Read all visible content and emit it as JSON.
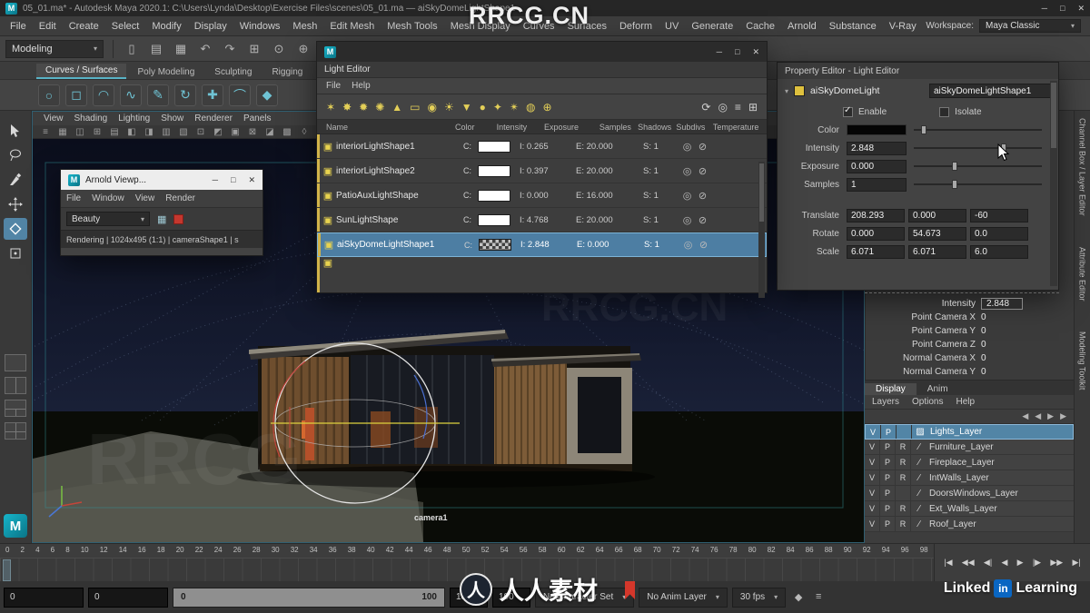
{
  "title_bar": {
    "title": "05_01.ma* - Autodesk Maya 2020.1: C:\\Users\\Lynda\\Desktop\\Exercise Files\\scenes\\05_01.ma — aiSkyDomeLightShape1",
    "app_icon": "M",
    "controls": [
      "─",
      "□",
      "✕"
    ]
  },
  "menu_bar": {
    "items": [
      "File",
      "Edit",
      "Create",
      "Select",
      "Modify",
      "Display",
      "Windows",
      "Mesh",
      "Edit Mesh",
      "Mesh Tools",
      "Mesh Display",
      "Curves",
      "Surfaces",
      "Deform",
      "UV",
      "Generate",
      "Cache",
      "Arnold",
      "Substance",
      "V-Ray"
    ],
    "workspace_label": "Workspace:",
    "workspace_value": "Maya Classic"
  },
  "toolbar": {
    "mode": "Modeling",
    "icons": [
      {
        "name": "new-scene-icon",
        "glyph": "▯"
      },
      {
        "name": "open-scene-icon",
        "glyph": "▤"
      },
      {
        "name": "save-scene-icon",
        "glyph": "▦"
      },
      {
        "name": "undo-icon",
        "glyph": "↶"
      },
      {
        "name": "redo-icon",
        "glyph": "↷"
      },
      {
        "name": "snap-to-grid-icon",
        "glyph": "⊞"
      },
      {
        "name": "snap-to-curve-icon",
        "glyph": "⊙"
      },
      {
        "name": "snap-to-point-icon",
        "glyph": "⊕"
      },
      {
        "name": "snap-to-plane-icon",
        "glyph": "▣"
      },
      {
        "name": "make-live-icon",
        "glyph": "◧"
      },
      {
        "name": "construction-history-icon",
        "glyph": "✛"
      },
      {
        "name": "render-icon",
        "glyph": "▩"
      }
    ]
  },
  "shelf": {
    "tabs": [
      "Curves / Surfaces",
      "Poly Modeling",
      "Sculpting",
      "Rigging"
    ],
    "icons": [
      {
        "name": "nurbs-circle-icon",
        "glyph": "○"
      },
      {
        "name": "nurbs-square-icon",
        "glyph": "◻"
      },
      {
        "name": "curve-arc-icon",
        "glyph": "◠"
      },
      {
        "name": "freehand-curve-icon",
        "glyph": "∿"
      },
      {
        "name": "pencil-curve-icon",
        "glyph": "✎"
      },
      {
        "name": "revolve-icon",
        "glyph": "↻"
      },
      {
        "name": "add-points-icon",
        "glyph": "✚"
      },
      {
        "name": "arc-tool-icon",
        "glyph": "⌒"
      },
      {
        "name": "bezier-icon",
        "glyph": "◆"
      }
    ]
  },
  "viewport": {
    "menus": [
      "View",
      "Shading",
      "Lighting",
      "Show",
      "Renderer",
      "Panels"
    ],
    "icons": [
      {
        "name": "select-camera-icon",
        "glyph": "≡"
      },
      {
        "name": "grid-toggle-icon",
        "glyph": "▦"
      },
      {
        "name": "film-gate-icon",
        "glyph": "◫"
      },
      {
        "name": "resolution-gate-icon",
        "glyph": "⊞"
      },
      {
        "name": "gate-mask-icon",
        "glyph": "▤"
      },
      {
        "name": "field-chart-icon",
        "glyph": "◧"
      },
      {
        "name": "safe-action-icon",
        "glyph": "◨"
      },
      {
        "name": "safe-title-icon",
        "glyph": "▥"
      },
      {
        "name": "wireframe-icon",
        "glyph": "▧"
      },
      {
        "name": "shaded-icon",
        "glyph": "⊡"
      },
      {
        "name": "textured-icon",
        "glyph": "◩"
      },
      {
        "name": "lighting-icon",
        "glyph": "▣"
      },
      {
        "name": "shadows-icon",
        "glyph": "⊠"
      },
      {
        "name": "ambient-occlusion-icon",
        "glyph": "◪"
      },
      {
        "name": "motion-blur-icon",
        "glyph": "▩"
      },
      {
        "name": "isolate-select-icon",
        "glyph": "◊"
      }
    ],
    "camera_label": "camera1"
  },
  "arnold_window": {
    "title": "Arnold Viewp...",
    "controls": [
      "─",
      "□",
      "✕"
    ],
    "menus": [
      "File",
      "Window",
      "View",
      "Render"
    ],
    "aov": "Beauty",
    "status": "Rendering | 1024x495 (1:1) | cameraShape1 | s"
  },
  "light_editor": {
    "title": "Light Editor",
    "controls": [
      "─",
      "□",
      "✕"
    ],
    "menus": [
      "File",
      "Help"
    ],
    "toolbar_left": [
      {
        "name": "directional-light-icon",
        "glyph": "✶"
      },
      {
        "name": "point-light-icon",
        "glyph": "✸"
      },
      {
        "name": "spot-light-icon",
        "glyph": "✹"
      },
      {
        "name": "area-light-icon",
        "glyph": "✺"
      },
      {
        "name": "volume-light-icon",
        "glyph": "▲"
      },
      {
        "name": "ambient-light-icon",
        "glyph": "▭"
      },
      {
        "name": "skydome-light-icon",
        "glyph": "◉"
      },
      {
        "name": "mesh-light-icon",
        "glyph": "☀"
      },
      {
        "name": "photometric-light-icon",
        "glyph": "▼"
      },
      {
        "name": "portal-light-icon",
        "glyph": "●"
      },
      {
        "name": "physical-sky-icon",
        "glyph": "✦"
      },
      {
        "name": "light-group-icon",
        "glyph": "✴"
      },
      {
        "name": "aov-light-group-icon",
        "glyph": "◍"
      },
      {
        "name": "add-light-icon",
        "glyph": "⊕"
      }
    ],
    "toolbar_right": [
      {
        "name": "refresh-icon",
        "glyph": "⟳"
      },
      {
        "name": "look-through-icon",
        "glyph": "◎"
      },
      {
        "name": "sort-icon",
        "glyph": "≡"
      },
      {
        "name": "filter-icon",
        "glyph": "⊞"
      }
    ],
    "columns": [
      "Name",
      "Color",
      "Intensity",
      "Exposure",
      "Samples",
      "Shadows",
      "Subdivs",
      "Temperature"
    ],
    "rows": [
      {
        "name": "interiorLightShape1",
        "color": "C:",
        "intensity": "I: 0.265",
        "exposure": "E: 20.000",
        "samples": "S: 1",
        "swatch": "white",
        "selected": false
      },
      {
        "name": "interiorLightShape2",
        "color": "C:",
        "intensity": "I: 0.397",
        "exposure": "E: 20.000",
        "samples": "S: 1",
        "swatch": "white",
        "selected": false
      },
      {
        "name": "PatioAuxLightShape",
        "color": "C:",
        "intensity": "I: 0.000",
        "exposure": "E: 16.000",
        "samples": "S: 1",
        "swatch": "white",
        "selected": false
      },
      {
        "name": "SunLightShape",
        "color": "C:",
        "intensity": "I: 4.768",
        "exposure": "E: 20.000",
        "samples": "S: 1",
        "swatch": "white",
        "selected": false
      },
      {
        "name": "aiSkyDomeLightShape1",
        "color": "C:",
        "intensity": "I: 2.848",
        "exposure": "E: 0.000",
        "samples": "S: 1",
        "swatch": "checker",
        "selected": true
      }
    ]
  },
  "property_editor": {
    "title": "Property Editor - Light Editor",
    "node_type": "aiSkyDomeLight",
    "node_name": "aiSkyDomeLightShape1",
    "enable_label": "Enable",
    "isolate_label": "Isolate",
    "color_label": "Color",
    "sliders": [
      {
        "label": "Intensity",
        "value": "2.848"
      },
      {
        "label": "Exposure",
        "value": "0.000"
      },
      {
        "label": "Samples",
        "value": "1"
      }
    ],
    "transform_rows": [
      {
        "label": "Translate",
        "values": [
          "208.293",
          "0.000",
          "-60"
        ]
      },
      {
        "label": "Rotate",
        "values": [
          "0.000",
          "54.673",
          "0.0"
        ]
      },
      {
        "label": "Scale",
        "values": [
          "6.071",
          "6.071",
          "6.0"
        ]
      }
    ]
  },
  "channel_box": {
    "rows": [
      {
        "label": "Intensity",
        "value": "2.848",
        "highlight": true
      },
      {
        "label": "Point Camera X",
        "value": "0",
        "highlight": false
      },
      {
        "label": "Point Camera Y",
        "value": "0",
        "highlight": false
      },
      {
        "label": "Point Camera Z",
        "value": "0",
        "highlight": false
      },
      {
        "label": "Normal Camera X",
        "value": "0",
        "highlight": false
      },
      {
        "label": "Normal Camera Y",
        "value": "0",
        "highlight": false
      }
    ]
  },
  "layer_panel": {
    "tabs": [
      "Display",
      "Anim"
    ],
    "menus": [
      "Layers",
      "Options",
      "Help"
    ],
    "icons": [
      {
        "name": "layer-move-up-icon",
        "glyph": "◀"
      },
      {
        "name": "layer-move-down-icon",
        "glyph": "◀"
      },
      {
        "name": "layer-empty-icon",
        "glyph": "▶"
      },
      {
        "name": "layer-new-icon",
        "glyph": "▶"
      }
    ],
    "layers": [
      {
        "v": "V",
        "p": "P",
        "r": "",
        "name": "Lights_Layer",
        "selected": true
      },
      {
        "v": "V",
        "p": "P",
        "r": "R",
        "name": "Furniture_Layer",
        "selected": false
      },
      {
        "v": "V",
        "p": "P",
        "r": "R",
        "name": "Fireplace_Layer",
        "selected": false
      },
      {
        "v": "V",
        "p": "P",
        "r": "R",
        "name": "IntWalls_Layer",
        "selected": false
      },
      {
        "v": "V",
        "p": "P",
        "r": "",
        "name": "DoorsWindows_Layer",
        "selected": false
      },
      {
        "v": "V",
        "p": "P",
        "r": "R",
        "name": "Ext_Walls_Layer",
        "selected": false
      },
      {
        "v": "V",
        "p": "P",
        "r": "R",
        "name": "Roof_Layer",
        "selected": false
      }
    ]
  },
  "side_tabs": [
    "Channel Box / Layer Editor",
    "Attribute Editor",
    "Modeling Toolkit"
  ],
  "timeline": {
    "labels": [
      "0",
      "2",
      "4",
      "6",
      "8",
      "10",
      "12",
      "14",
      "16",
      "18",
      "20",
      "22",
      "24",
      "26",
      "28",
      "30",
      "32",
      "34",
      "36",
      "38",
      "40",
      "42",
      "44",
      "46",
      "48",
      "50",
      "52",
      "54",
      "56",
      "58",
      "60",
      "62",
      "64",
      "66",
      "68",
      "70",
      "72",
      "74",
      "76",
      "78",
      "80",
      "82",
      "84",
      "86",
      "88",
      "90",
      "92",
      "94",
      "96",
      "98"
    ],
    "playback": [
      {
        "name": "go-to-start-button",
        "glyph": "|◀"
      },
      {
        "name": "step-back-frame-button",
        "glyph": "◀◀"
      },
      {
        "name": "step-back-key-button",
        "glyph": "◀|"
      },
      {
        "name": "play-backwards-button",
        "glyph": "◀"
      },
      {
        "name": "play-forward-button",
        "glyph": "▶"
      },
      {
        "name": "step-forward-key-button",
        "glyph": "|▶"
      },
      {
        "name": "step-forward-frame-button",
        "glyph": "▶▶"
      },
      {
        "name": "go-to-end-button",
        "glyph": "▶|"
      }
    ]
  },
  "range_bar": {
    "anim_start": "0",
    "playback_start": "0",
    "range_start": "0",
    "range_end": "100",
    "playback_end": "100",
    "anim_end": "100",
    "character_set": "No Character Set",
    "anim_layer": "No Anim Layer",
    "fps": "30 fps",
    "icons": [
      {
        "name": "auto-keyframe-icon",
        "glyph": "◆"
      },
      {
        "name": "anim-preferences-icon",
        "glyph": "≡"
      }
    ]
  },
  "watermarks": {
    "top": "RRCG.CN",
    "viewport_a": "RRCG",
    "viewport_b": "RRCG.CN",
    "bottom_logo_char": "人",
    "bottom_text": "人人素材",
    "linkedin_left": "Linked",
    "linkedin_in": "in",
    "linkedin_right": "Learning"
  }
}
